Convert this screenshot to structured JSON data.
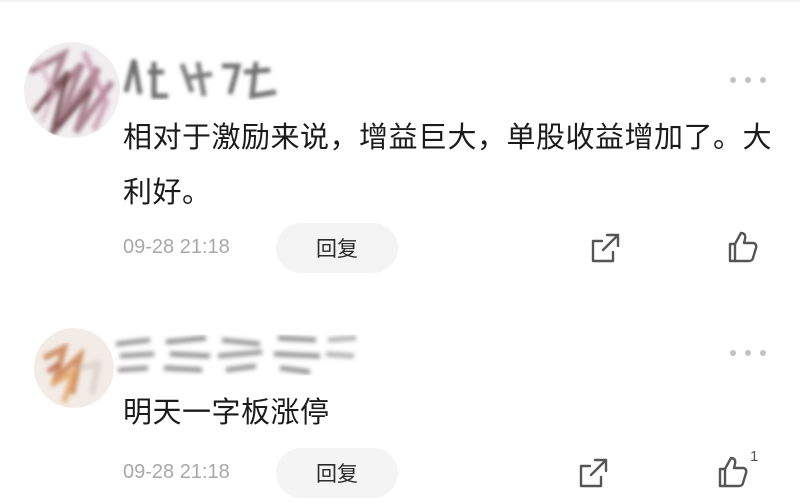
{
  "comments": [
    {
      "text": "相对于激励来说，增益巨大，单股收益增加了。大利好。",
      "time": "09-28 21:18",
      "reply_label": "回复",
      "like_count": ""
    },
    {
      "text": "明天一字板涨停",
      "time": "09-28 21:18",
      "reply_label": "回复",
      "like_count": "1"
    }
  ],
  "icons": {
    "more": "more-dots-icon",
    "share": "share-icon",
    "like": "thumbs-up-icon"
  },
  "colors": {
    "text": "#1b1b1b",
    "meta": "#a8a8a8",
    "reply_bg": "#f4f4f4",
    "icon": "#555555"
  }
}
